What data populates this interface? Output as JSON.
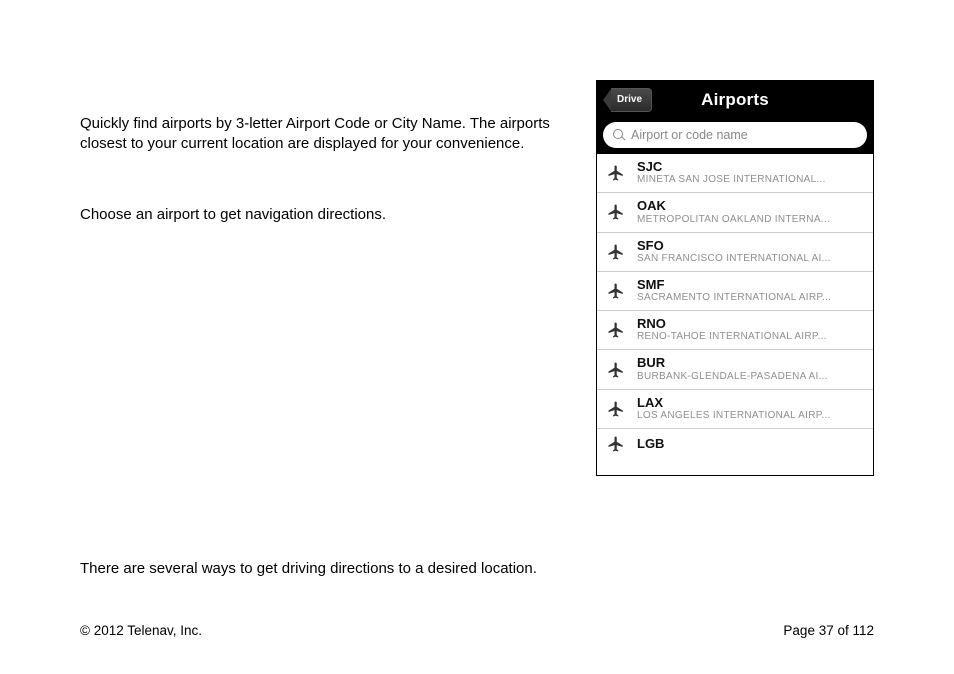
{
  "body": {
    "para1": "Quickly find airports by 3-letter Airport Code or City Name. The airports closest to your current location are displayed for your convenience.",
    "para2": "Choose an airport to get navigation directions.",
    "para3": "There are several ways to get driving directions to a desired location."
  },
  "footer": {
    "copyright": "© 2012 Telenav, Inc.",
    "page": "Page 37 of 112"
  },
  "phone": {
    "back_label": "Drive",
    "title": "Airports",
    "search_placeholder": "Airport or code name",
    "airports": [
      {
        "code": "SJC",
        "desc": "MINETA SAN JOSE INTERNATIONAL..."
      },
      {
        "code": "OAK",
        "desc": "METROPOLITAN OAKLAND INTERNA..."
      },
      {
        "code": "SFO",
        "desc": "SAN FRANCISCO INTERNATIONAL AI..."
      },
      {
        "code": "SMF",
        "desc": "SACRAMENTO INTERNATIONAL AIRP..."
      },
      {
        "code": "RNO",
        "desc": "RENO-TAHOE INTERNATIONAL AIRP..."
      },
      {
        "code": "BUR",
        "desc": "BURBANK-GLENDALE-PASADENA AI..."
      },
      {
        "code": "LAX",
        "desc": "LOS ANGELES INTERNATIONAL AIRP..."
      },
      {
        "code": "LGB",
        "desc": ""
      }
    ]
  }
}
